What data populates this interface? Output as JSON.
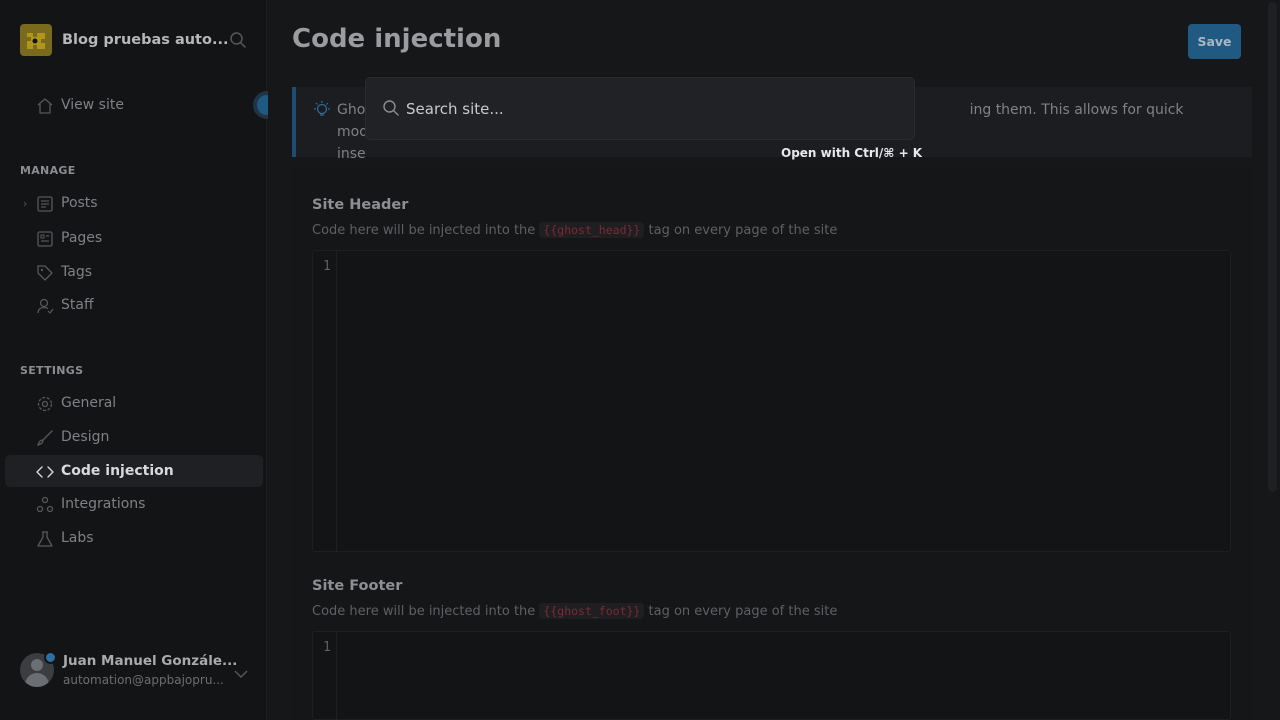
{
  "sidebar": {
    "site_title": "Blog pruebas auto...",
    "view_site": "View site",
    "manage_label": "MANAGE",
    "manage_items": [
      {
        "label": "Posts",
        "icon": "posts-icon"
      },
      {
        "label": "Pages",
        "icon": "pages-icon"
      },
      {
        "label": "Tags",
        "icon": "tag-icon"
      },
      {
        "label": "Staff",
        "icon": "staff-icon"
      }
    ],
    "settings_label": "SETTINGS",
    "settings_items": [
      {
        "label": "General",
        "icon": "gear-icon"
      },
      {
        "label": "Design",
        "icon": "brush-icon"
      },
      {
        "label": "Code injection",
        "icon": "code-icon",
        "active": true
      },
      {
        "label": "Integrations",
        "icon": "integrations-icon"
      },
      {
        "label": "Labs",
        "icon": "flask-icon"
      }
    ],
    "user": {
      "name": "Juan Manuel Gonzále...",
      "email": "automation@appbajopru..."
    }
  },
  "main": {
    "title": "Code injection",
    "save_label": "Save",
    "info_text_visible": "Ghos                                                                                                                    ting them. This allows for quick modifications to",
    "info_text_line1_start": "Ghos",
    "info_text_line1_end": "ing them. This allows for quick modifications to",
    "info_text_line2_start": "inse",
    "header": {
      "title": "Site Header",
      "desc_before": "Code here will be injected into the",
      "code": "{{ghost_head}}",
      "desc_after": "tag on every page of the site",
      "line_number": "1"
    },
    "footer": {
      "title": "Site Footer",
      "desc_before": "Code here will be injected into the",
      "code": "{{ghost_foot}}",
      "desc_after": "tag on every page of the site",
      "line_number": "1"
    }
  },
  "search": {
    "placeholder": "Search site...",
    "hint": "Open with Ctrl/⌘ + K"
  },
  "colors": {
    "accent": "#205a82",
    "background": "#15171a",
    "code": "#7a2b38"
  }
}
